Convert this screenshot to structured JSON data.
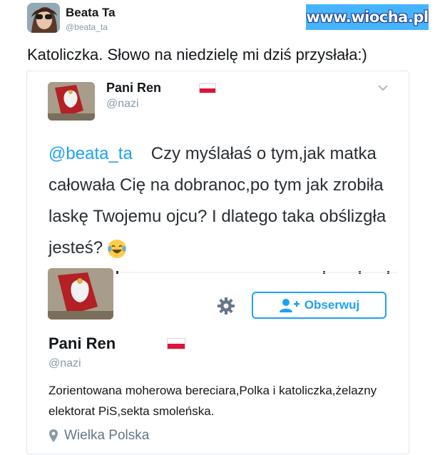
{
  "header": {
    "name": "Beata Ta",
    "handle": "@beata_ta"
  },
  "watermark": "www.wiocha.pl",
  "caption": "Katoliczka. Słowo na niedzielę mi dziś przysłała:)",
  "embedded_tweet": {
    "name": "Pani Ren",
    "handle": "@nazi",
    "mention": "@beata_ta",
    "text": "Czy myślałaś o tym,jak matka całowała Cię na dobranoc,po tym jak zrobiła laskę Twojemu ojcu? I dlatego taka obślizgła jesteś?",
    "emoji": "😂"
  },
  "profile_card": {
    "name": "Pani Ren",
    "handle": "@nazi",
    "follow_label": "Obserwuj",
    "bio": "Zorientowana moherowa bereciara,Polka i katoliczka,żelazny elektorat PiS,sekta smoleńska.",
    "location": "Wielka Polska"
  },
  "colors": {
    "accent": "#1da1f2",
    "flag_red": "#dc143c",
    "watermark_bg": "#46b4ff"
  },
  "icons": [
    "chevron-down-icon",
    "gear-icon",
    "add-user-icon",
    "location-pin-icon",
    "flag-icon"
  ]
}
